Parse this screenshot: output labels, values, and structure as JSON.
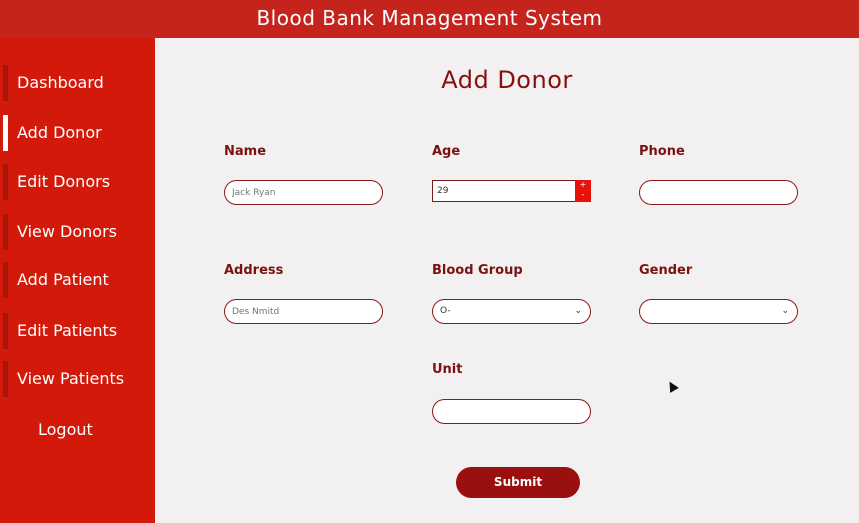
{
  "header": {
    "title": "Blood Bank Management System"
  },
  "sidebar": {
    "items": [
      {
        "label": "Dashboard"
      },
      {
        "label": "Add Donor"
      },
      {
        "label": "Edit Donors"
      },
      {
        "label": "View Donors"
      },
      {
        "label": "Add Patient"
      },
      {
        "label": "Edit Patients"
      },
      {
        "label": "View Patients"
      },
      {
        "label": "Logout"
      }
    ],
    "active": "Add Donor"
  },
  "form": {
    "title": "Add Donor",
    "name": {
      "label": "Name",
      "placeholder": "Jack Ryan"
    },
    "age": {
      "label": "Age",
      "value": "29"
    },
    "phone": {
      "label": "Phone",
      "placeholder": ""
    },
    "address": {
      "label": "Address",
      "placeholder": "Des Nmitd"
    },
    "blood_group": {
      "label": "Blood Group",
      "value": "O-"
    },
    "gender": {
      "label": "Gender",
      "value": ""
    },
    "unit": {
      "label": "Unit",
      "placeholder": ""
    },
    "submit_label": "Submit"
  },
  "colors": {
    "accent": "#d31a0a",
    "header": "#c4241c",
    "button": "#9a0f0f",
    "label": "#7a1212"
  }
}
